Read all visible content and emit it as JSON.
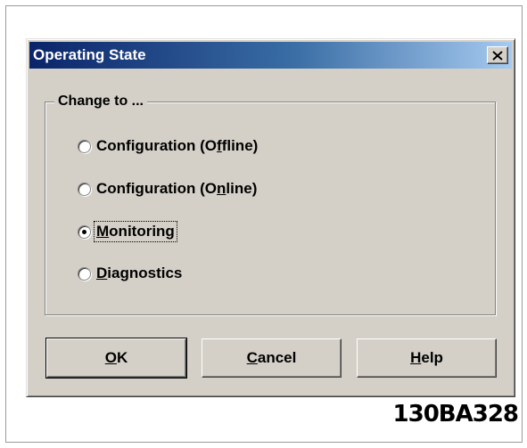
{
  "dialog": {
    "title": "Operating State",
    "close_symbol": "×"
  },
  "group": {
    "legend": "Change to ..."
  },
  "options": [
    {
      "label_pre": "Configuration (O",
      "label_key": "f",
      "label_post": "fline)",
      "checked": false
    },
    {
      "label_pre": "Configuration (O",
      "label_key": "n",
      "label_post": "line)",
      "checked": false
    },
    {
      "label_pre": "",
      "label_key": "M",
      "label_post": "onitoring",
      "checked": true,
      "focused": true
    },
    {
      "label_pre": "",
      "label_key": "D",
      "label_post": "iagnostics",
      "checked": false
    }
  ],
  "buttons": {
    "ok": {
      "key": "O",
      "rest": "K"
    },
    "cancel": {
      "key": "C",
      "rest": "ancel"
    },
    "help": {
      "key": "H",
      "rest": "elp"
    }
  },
  "figure_code": "130BA328"
}
